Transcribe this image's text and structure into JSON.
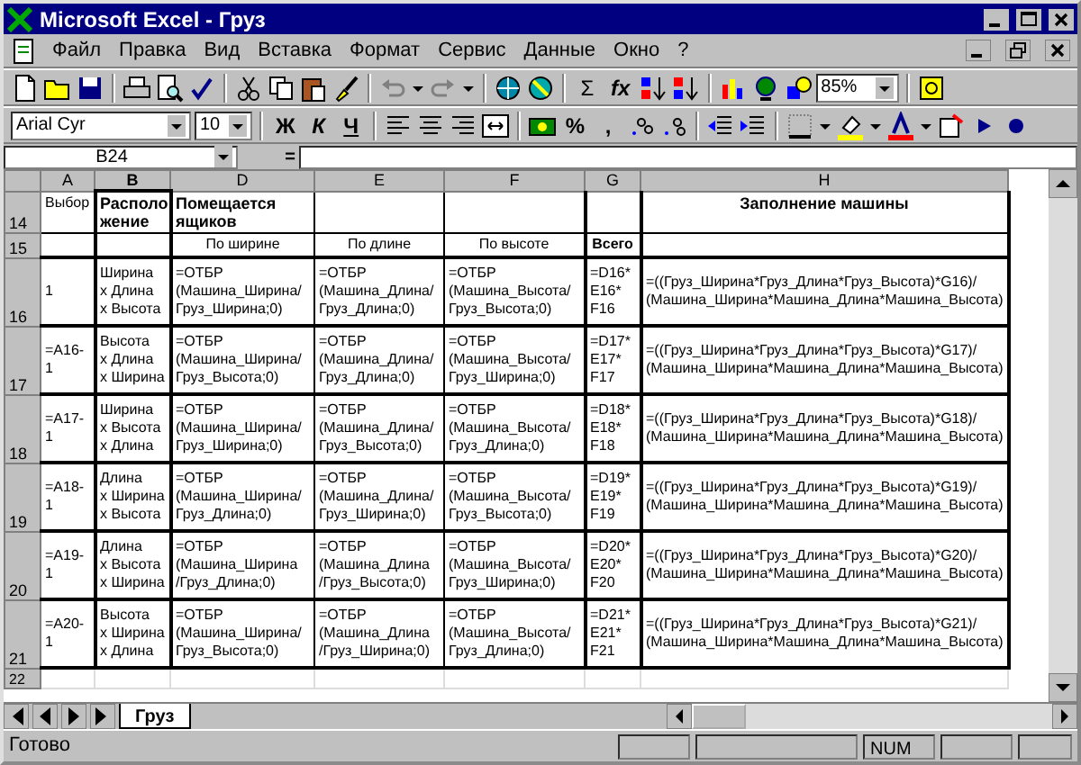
{
  "window": {
    "title": "Microsoft Excel - Груз"
  },
  "menu": [
    "Файл",
    "Правка",
    "Вид",
    "Вставка",
    "Формат",
    "Сервис",
    "Данные",
    "Окно",
    "?"
  ],
  "standard_toolbar": {
    "sum": "Σ",
    "function": "fx",
    "zoom": "85%"
  },
  "formatting_toolbar": {
    "font": "Arial Cyr",
    "size": "10",
    "style_buttons": [
      "Ж",
      "К",
      "Ч"
    ],
    "percent": "%",
    "comma": ","
  },
  "formula_bar": {
    "name_box": "B24",
    "equals": "="
  },
  "columns": [
    {
      "label": "A",
      "selected": false
    },
    {
      "label": "B",
      "selected": true
    },
    {
      "label": "D",
      "selected": false
    },
    {
      "label": "E",
      "selected": false
    },
    {
      "label": "F",
      "selected": false
    },
    {
      "label": "G",
      "selected": false
    },
    {
      "label": "H",
      "selected": false
    }
  ],
  "rows": [
    {
      "number": "14",
      "kind": "header",
      "cells": [
        {
          "text": "Выбор",
          "bold": false
        },
        {
          "text": "Располо\nжение",
          "bold": true
        },
        {
          "text": "Помещается\nящиков",
          "bold": true
        },
        null,
        null,
        null,
        {
          "text": "Заполнение машины",
          "bold": true
        }
      ]
    },
    {
      "number": "15",
      "kind": "header",
      "cells": [
        null,
        null,
        {
          "text": "По ширине",
          "bold": false
        },
        {
          "text": "По длине",
          "bold": false
        },
        {
          "text": "По высоте",
          "bold": false
        },
        {
          "text": "Всего",
          "bold": true
        },
        null
      ]
    },
    {
      "number": "16",
      "kind": "data",
      "cells": [
        "1",
        "Ширина\nx Длина\nx Высота",
        "=ОТБР\n(Машина_Ширина/\nГруз_Ширина;0)",
        "=ОТБР\n(Машина_Длина/\nГруз_Длина;0)",
        "=ОТБР\n(Машина_Высота/\nГруз_Высота;0)",
        "=D16*\nE16*\nF16",
        "=((Груз_Ширина*Груз_Длина*Груз_Высота)*G16)/\n(Машина_Ширина*Машина_Длина*Машина_Высота)"
      ]
    },
    {
      "number": "17",
      "kind": "data",
      "cells": [
        "=A16-1",
        "Высота\nx Длина\nx Ширина",
        "=ОТБР\n(Машина_Ширина/\nГруз_Высота;0)",
        "=ОТБР\n(Машина_Длина/\nГруз_Длина;0)",
        "=ОТБР\n(Машина_Высота/\nГруз_Ширина;0)",
        "=D17*\nE17*\nF17",
        "=((Груз_Ширина*Груз_Длина*Груз_Высота)*G17)/\n(Машина_Ширина*Машина_Длина*Машина_Высота)"
      ]
    },
    {
      "number": "18",
      "kind": "data",
      "cells": [
        "=A17-1",
        "Ширина\nx Высота\nx Длина",
        "=ОТБР\n(Машина_Ширина/\nГруз_Ширина;0)",
        "=ОТБР\n(Машина_Длина/\nГруз_Высота;0)",
        "=ОТБР\n(Машина_Высота/\nГруз_Длина;0)",
        "=D18*\nE18*\nF18",
        "=((Груз_Ширина*Груз_Длина*Груз_Высота)*G18)/\n(Машина_Ширина*Машина_Длина*Машина_Высота)"
      ]
    },
    {
      "number": "19",
      "kind": "data",
      "cells": [
        "=A18-1",
        "Длина\nx Ширина\nx Высота",
        "=ОТБР\n(Машина_Ширина/\nГруз_Длина;0)",
        "=ОТБР\n(Машина_Длина/\nГруз_Ширина;0)",
        "=ОТБР\n(Машина_Высота/\nГруз_Высота;0)",
        "=D19*\nE19*\nF19",
        "=((Груз_Ширина*Груз_Длина*Груз_Высота)*G19)/\n(Машина_Ширина*Машина_Длина*Машина_Высота)"
      ]
    },
    {
      "number": "20",
      "kind": "data",
      "cells": [
        "=A19-1",
        "Длина\nx Высота\nx Ширина",
        "=ОТБР\n(Машина_Ширина\n/Груз_Длина;0)",
        "=ОТБР\n(Машина_Длина\n/Груз_Высота;0)",
        "=ОТБР\n(Машина_Высота/\nГруз_Ширина;0)",
        "=D20*\nE20*\nF20",
        "=((Груз_Ширина*Груз_Длина*Груз_Высота)*G20)/\n(Машина_Ширина*Машина_Длина*Машина_Высота)"
      ]
    },
    {
      "number": "21",
      "kind": "data",
      "cells": [
        "=A20-1",
        "Высота\nx Ширина\nx Длина",
        "=ОТБР\n(Машина_Ширина/\nГруз_Высота;0)",
        "=ОТБР\n(Машина_Длина\n/Груз_Ширина;0)",
        "=ОТБР\n(Машина_Высота/\nГруз_Длина;0)",
        "=D21*\nE21*\nF21",
        "=((Груз_Ширина*Груз_Длина*Груз_Высота)*G21)/\n(Машина_Ширина*Машина_Длина*Машина_Высота)"
      ]
    },
    {
      "number": "22",
      "kind": "empty",
      "cells": []
    }
  ],
  "sheet_tabs": [
    {
      "label": "Груз",
      "selected": true
    }
  ],
  "status_bar": {
    "text": "Готово",
    "indicators": [
      "NUM"
    ]
  }
}
